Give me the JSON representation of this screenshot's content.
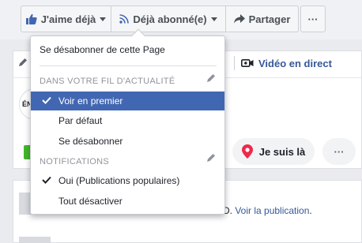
{
  "toolbar": {
    "like_label": "J'aime déjà",
    "subscribe_label": "Déjà abonné(e)",
    "share_label": "Partager",
    "more_label": "···"
  },
  "background": {
    "live_video_label": "Vidéo en direct",
    "avatar_text": "ÉN",
    "here_label": "Je suis là",
    "more_label": "···",
    "post_prefix": "D.",
    "post_link": "Voir la publication",
    "post_suffix": "."
  },
  "dropdown": {
    "unsubscribe_page": "Se désabonner de cette Page",
    "feed_header": "DANS VOTRE FIL D'ACTUALITÉ",
    "see_first": "Voir en premier",
    "default": "Par défaut",
    "unfollow": "Se désabonner",
    "notifications_header": "NOTIFICATIONS",
    "on_highlights": "Oui (Publications populaires)",
    "all_off": "Tout désactiver"
  },
  "colors": {
    "accent": "#4267b2",
    "link": "#365899",
    "live": "#365899",
    "pin": "#f02849"
  }
}
